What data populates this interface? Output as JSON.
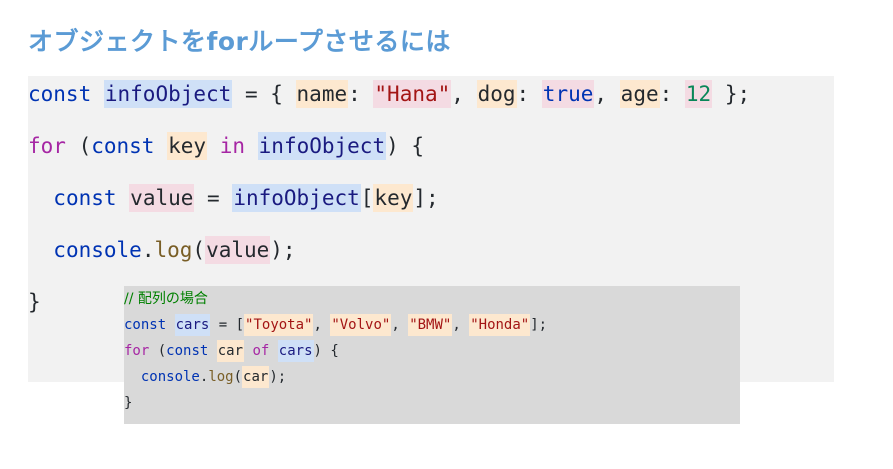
{
  "title": "オブジェクトをforループさせるには",
  "colors": {
    "title": "#5b9bd5",
    "keyword": "#0033b3",
    "control": "#a626a4",
    "plain": "#24292e",
    "string": "#a31515",
    "boolean": "#0033b3",
    "number": "#098658",
    "property": "#1a1a80",
    "function": "#795e26",
    "comment": "#008000",
    "hl_blue": "#cfe0f7",
    "hl_orange": "#fde8cf",
    "hl_pink": "#f4dbe3",
    "hl_green": "#d9efd5"
  },
  "main_code": {
    "lines": [
      [
        {
          "t": "const",
          "c": "keyword"
        },
        {
          "t": " ",
          "c": "plain"
        },
        {
          "t": "infoObject",
          "c": "property",
          "h": "hl_blue"
        },
        {
          "t": " = { ",
          "c": "plain"
        },
        {
          "t": "name",
          "c": "plain",
          "h": "hl_orange"
        },
        {
          "t": ": ",
          "c": "plain"
        },
        {
          "t": "\"Hana\"",
          "c": "string",
          "h": "hl_pink"
        },
        {
          "t": ", ",
          "c": "plain"
        },
        {
          "t": "dog",
          "c": "plain",
          "h": "hl_orange"
        },
        {
          "t": ": ",
          "c": "plain"
        },
        {
          "t": "true",
          "c": "boolean",
          "h": "hl_pink"
        },
        {
          "t": ", ",
          "c": "plain"
        },
        {
          "t": "age",
          "c": "plain",
          "h": "hl_orange"
        },
        {
          "t": ": ",
          "c": "plain"
        },
        {
          "t": "12",
          "c": "number",
          "h": "hl_pink"
        },
        {
          "t": " };",
          "c": "plain"
        }
      ],
      [
        {
          "t": "for",
          "c": "control"
        },
        {
          "t": " (",
          "c": "plain"
        },
        {
          "t": "const",
          "c": "keyword"
        },
        {
          "t": " ",
          "c": "plain"
        },
        {
          "t": "key",
          "c": "plain",
          "h": "hl_orange"
        },
        {
          "t": " ",
          "c": "plain"
        },
        {
          "t": "in",
          "c": "control"
        },
        {
          "t": " ",
          "c": "plain"
        },
        {
          "t": "infoObject",
          "c": "property",
          "h": "hl_blue"
        },
        {
          "t": ") {",
          "c": "plain"
        }
      ],
      [
        {
          "t": "  ",
          "c": "plain"
        },
        {
          "t": "const",
          "c": "keyword"
        },
        {
          "t": " ",
          "c": "plain"
        },
        {
          "t": "value",
          "c": "plain",
          "h": "hl_pink"
        },
        {
          "t": " = ",
          "c": "plain"
        },
        {
          "t": "infoObject",
          "c": "property",
          "h": "hl_blue"
        },
        {
          "t": "[",
          "c": "plain"
        },
        {
          "t": "key",
          "c": "plain",
          "h": "hl_orange"
        },
        {
          "t": "];",
          "c": "plain"
        }
      ],
      [
        {
          "t": "  ",
          "c": "plain"
        },
        {
          "t": "console",
          "c": "keyword"
        },
        {
          "t": ".",
          "c": "plain"
        },
        {
          "t": "log",
          "c": "function"
        },
        {
          "t": "(",
          "c": "plain"
        },
        {
          "t": "value",
          "c": "plain",
          "h": "hl_pink"
        },
        {
          "t": ");",
          "c": "plain"
        }
      ],
      [
        {
          "t": "}",
          "c": "plain"
        }
      ]
    ]
  },
  "inset_code": {
    "lines": [
      [
        {
          "t": "// 配列の場合",
          "c": "comment",
          "cm": true
        }
      ],
      [
        {
          "t": "const",
          "c": "keyword"
        },
        {
          "t": " ",
          "c": "plain"
        },
        {
          "t": "cars",
          "c": "property",
          "h": "hl_blue"
        },
        {
          "t": " = [",
          "c": "plain"
        },
        {
          "t": "\"Toyota\"",
          "c": "string",
          "h": "hl_orange"
        },
        {
          "t": ", ",
          "c": "plain"
        },
        {
          "t": "\"Volvo\"",
          "c": "string",
          "h": "hl_orange"
        },
        {
          "t": ", ",
          "c": "plain"
        },
        {
          "t": "\"BMW\"",
          "c": "string",
          "h": "hl_orange"
        },
        {
          "t": ", ",
          "c": "plain"
        },
        {
          "t": "\"Honda\"",
          "c": "string",
          "h": "hl_orange"
        },
        {
          "t": "];",
          "c": "plain"
        }
      ],
      [
        {
          "t": "for",
          "c": "control"
        },
        {
          "t": " (",
          "c": "plain"
        },
        {
          "t": "const",
          "c": "keyword"
        },
        {
          "t": " ",
          "c": "plain"
        },
        {
          "t": "car",
          "c": "plain",
          "h": "hl_orange"
        },
        {
          "t": " ",
          "c": "plain"
        },
        {
          "t": "of",
          "c": "control"
        },
        {
          "t": " ",
          "c": "plain"
        },
        {
          "t": "cars",
          "c": "property",
          "h": "hl_blue"
        },
        {
          "t": ") {",
          "c": "plain"
        }
      ],
      [
        {
          "t": "  ",
          "c": "plain"
        },
        {
          "t": "console",
          "c": "keyword"
        },
        {
          "t": ".",
          "c": "plain"
        },
        {
          "t": "log",
          "c": "function"
        },
        {
          "t": "(",
          "c": "plain"
        },
        {
          "t": "car",
          "c": "plain",
          "h": "hl_orange"
        },
        {
          "t": ");",
          "c": "plain"
        }
      ],
      [
        {
          "t": "}",
          "c": "plain"
        }
      ]
    ]
  }
}
